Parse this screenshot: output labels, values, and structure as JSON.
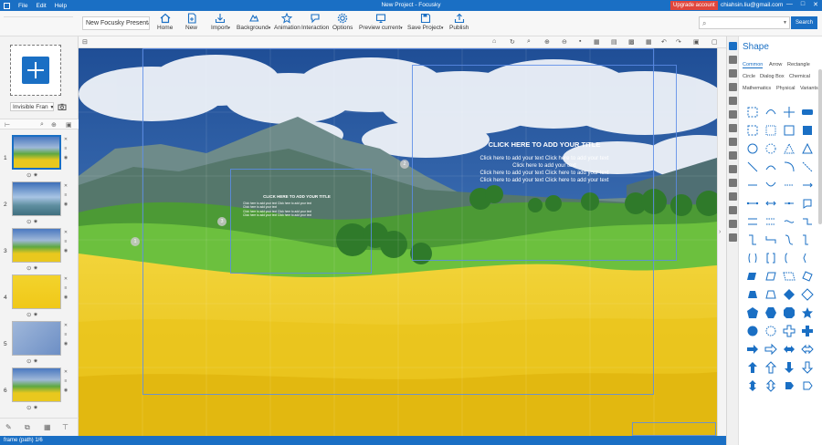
{
  "titlebar": {
    "menu": [
      "File",
      "Edit",
      "Help"
    ],
    "window_title": "New Project - Focusky",
    "upgrade_label": "Upgrade account",
    "email": "chiahsin.liu@gmail.com",
    "controls": [
      "—",
      "□",
      "✕"
    ]
  },
  "toolbar": {
    "project_name": "New Focusky Presenta",
    "buttons": [
      {
        "label": "Home",
        "icon": "home-icon"
      },
      {
        "label": "New",
        "icon": "new-icon"
      },
      {
        "label": "Import",
        "icon": "import-icon"
      },
      {
        "label": "Background",
        "icon": "background-icon"
      },
      {
        "label": "Animation",
        "icon": "animation-icon"
      },
      {
        "label": "Interaction",
        "icon": "interaction-icon"
      },
      {
        "label": "Options",
        "icon": "options-icon"
      },
      {
        "label": "Preview current",
        "icon": "preview-icon"
      },
      {
        "label": "Save Project",
        "icon": "save-icon"
      },
      {
        "label": "Publish",
        "icon": "publish-icon"
      }
    ],
    "search_placeholder": "",
    "search_label": "Search"
  },
  "left_panel": {
    "frame_type": "Invisible Fran",
    "frames": [
      {
        "num": "1",
        "selected": true,
        "style": "landscape"
      },
      {
        "num": "2",
        "selected": false,
        "style": "sky"
      },
      {
        "num": "3",
        "selected": false,
        "style": "landscape"
      },
      {
        "num": "4",
        "selected": false,
        "style": "yellow"
      },
      {
        "num": "5",
        "selected": false,
        "style": "blue"
      },
      {
        "num": "6",
        "selected": false,
        "style": "landscape"
      }
    ]
  },
  "canvas": {
    "main_title": "CLICK HERE TO ADD YOUR TITLE",
    "main_body": [
      "Click here to add your text Click here to add your text",
      "Click here to add your text",
      "Click here to add your text Click here to add your text",
      "Click here to add your text Click here to add your text"
    ],
    "small_title": "CLICK HERE TO ADD YOUR TITLE",
    "small_body": [
      "Click here to add your text Click here to add your text",
      "Click here to add your text",
      "Click here to add your text Click here to add your text",
      "Click here to add your text Click here to add your text"
    ],
    "badges": [
      "1",
      "2",
      "3"
    ]
  },
  "shape_panel": {
    "title": "Shape",
    "tabs": [
      "Common",
      "Arrow",
      "Rectangle",
      "Circle",
      "Dialog Box",
      "Chemical",
      "Mathematics",
      "Physical",
      "Variants"
    ],
    "active_tab": "Common",
    "accent": "#1a6fc4"
  },
  "statusbar": {
    "text": "frame (path) 1/6"
  }
}
